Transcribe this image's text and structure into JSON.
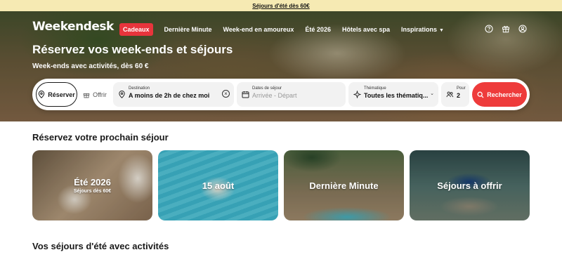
{
  "promo": {
    "text": "Séjours d'été dès 60€"
  },
  "header": {
    "logo": "Weekendesk",
    "nav": [
      {
        "label": "Cadeaux",
        "active": true
      },
      {
        "label": "Dernière Minute"
      },
      {
        "label": "Week-end en amoureux"
      },
      {
        "label": "Été 2026"
      },
      {
        "label": "Hôtels avec spa"
      },
      {
        "label": "Inspirations"
      }
    ],
    "icons": [
      "help-icon",
      "gift-icon",
      "user-icon"
    ]
  },
  "hero": {
    "title": "Réservez vos week-ends et séjours",
    "subtitle": "Week-ends avec activités, dès 60 €"
  },
  "search": {
    "tab_reserve": "Réserver",
    "tab_offer": "Offrir",
    "destination": {
      "label": "Destination",
      "value": "A moins de 2h de chez moi"
    },
    "dates": {
      "label": "Dates de séjour",
      "placeholder": "Arrivée - Départ"
    },
    "theme": {
      "label": "Thématique",
      "value": "Toutes les thématiq..."
    },
    "guests": {
      "label": "Pour",
      "value": "2"
    },
    "button": "Rechercher"
  },
  "section1": {
    "title": "Réservez votre prochain séjour",
    "cards": [
      {
        "title": "Été 2026",
        "subtitle": "Séjours dès 60€"
      },
      {
        "title": "15 août"
      },
      {
        "title": "Dernière Minute"
      },
      {
        "title": "Séjours à offrir"
      }
    ]
  },
  "section2": {
    "title": "Vos séjours d'été avec activités"
  },
  "colors": {
    "accent": "#ee3b3b",
    "nav_active": "#e8343c",
    "promo_bg": "#f6eab3"
  }
}
